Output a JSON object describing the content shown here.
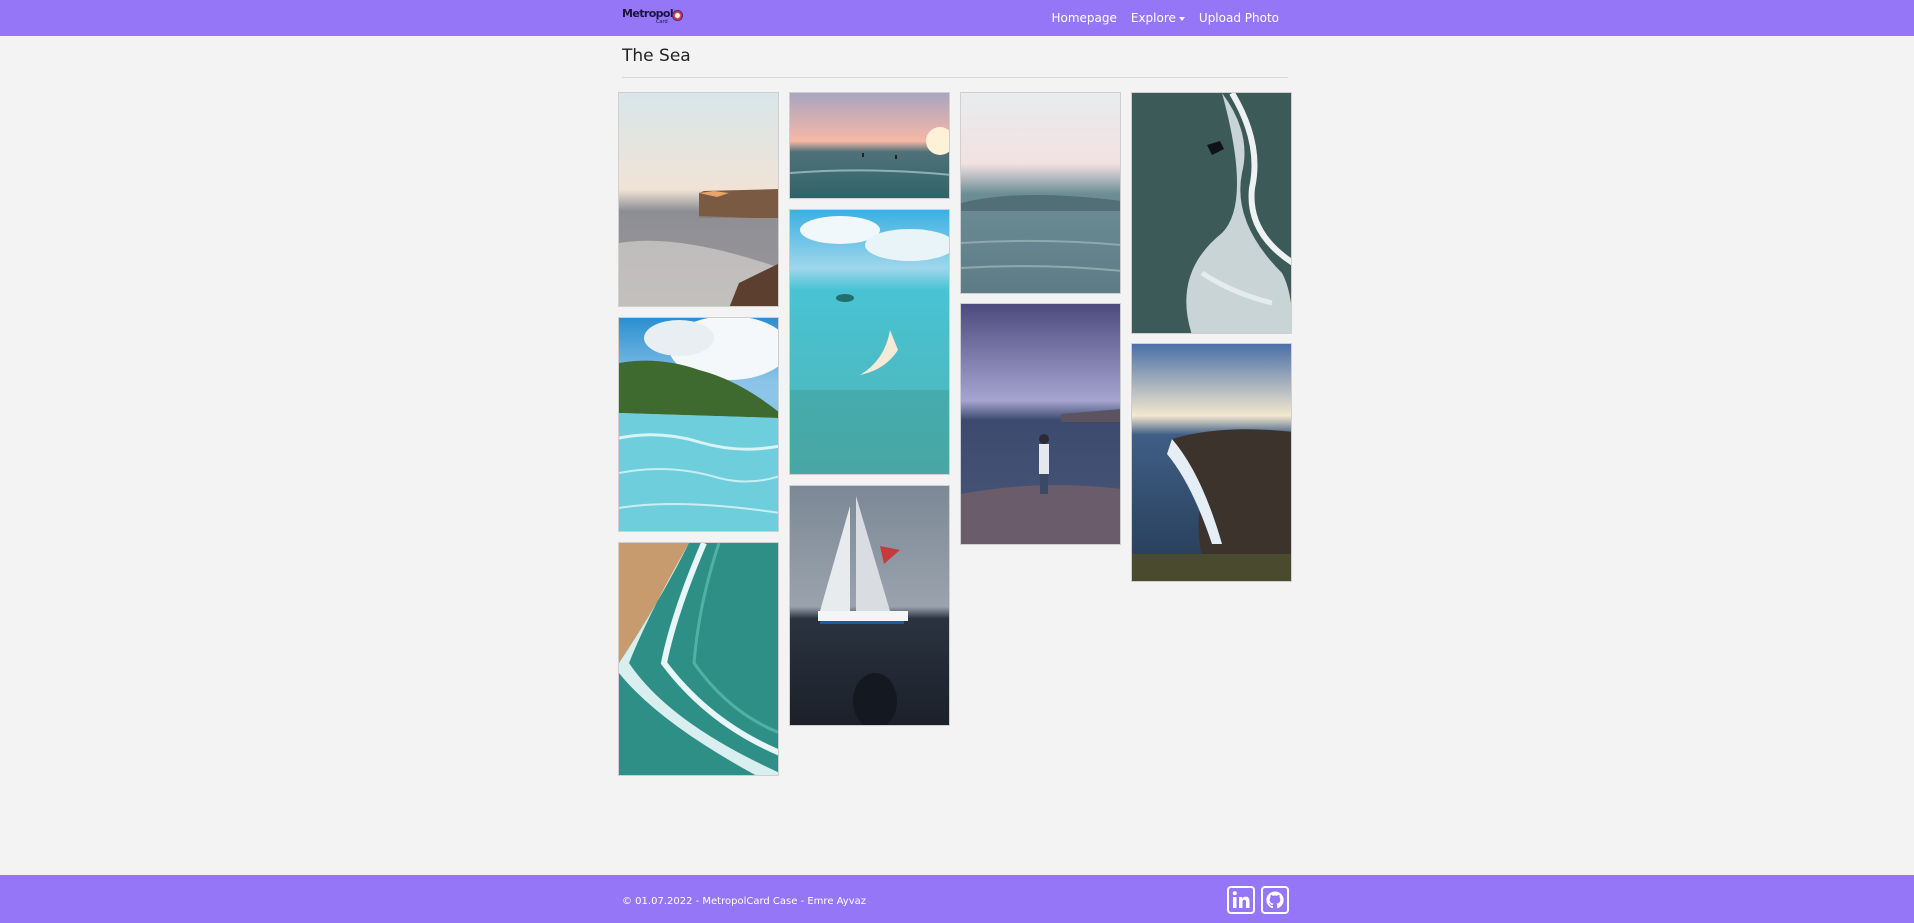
{
  "navbar": {
    "brand_name": "Metropol",
    "brand_sub": "Card",
    "links": [
      {
        "label": "Homepage",
        "icon": null
      },
      {
        "label": "Explore",
        "icon": "caret-down-icon"
      },
      {
        "label": "Upload Photo",
        "icon": null
      }
    ],
    "background": "#9476f6"
  },
  "page": {
    "title": "The Sea"
  },
  "gallery": {
    "photos": [
      {
        "subject": "cliff-at-sunset-coast"
      },
      {
        "subject": "tropical-beach-green-hills"
      },
      {
        "subject": "aerial-beach-waves"
      },
      {
        "subject": "sunset-surfers"
      },
      {
        "subject": "aerial-sandbar-turquoise"
      },
      {
        "subject": "sailboat-at-sea"
      },
      {
        "subject": "misty-calm-sea"
      },
      {
        "subject": "man-standing-on-rock"
      },
      {
        "subject": "surfer-on-wave"
      },
      {
        "subject": "coastal-cliff-dusk"
      }
    ]
  },
  "footer": {
    "copyright": "© 01.07.2022 - MetropolCard Case - Emre Ayvaz",
    "social": [
      {
        "icon": "linkedin-icon"
      },
      {
        "icon": "github-icon"
      }
    ],
    "background": "#9476f6"
  }
}
